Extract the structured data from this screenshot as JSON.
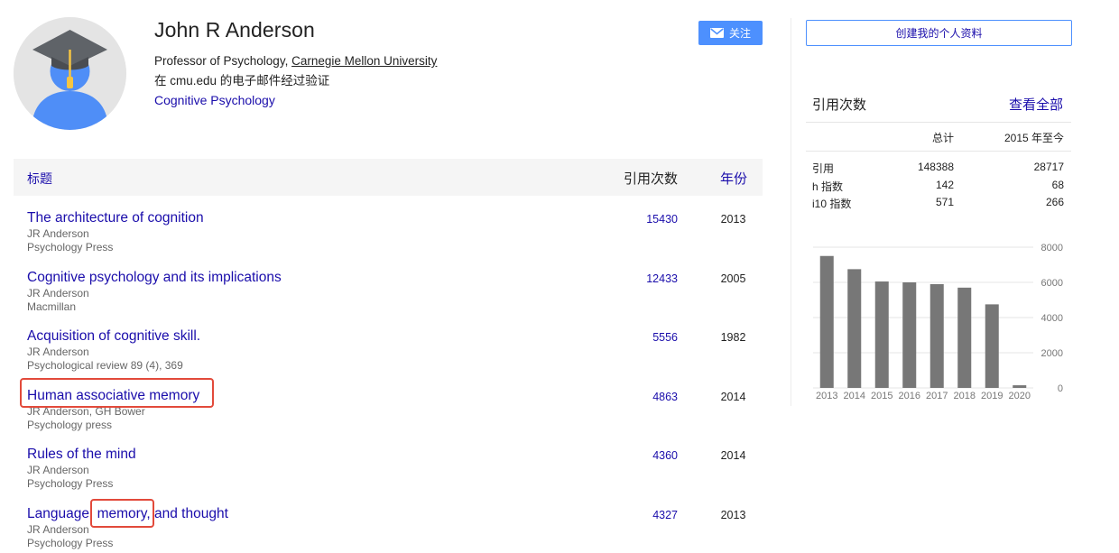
{
  "profile": {
    "name": "John R Anderson",
    "affiliation_prefix": "Professor of Psychology, ",
    "affiliation_org": "Carnegie Mellon University",
    "verified_email": "在 cmu.edu 的电子邮件经过验证",
    "interest": "Cognitive Psychology",
    "follow_label": "关注",
    "avatar_icon": "graduate-avatar-icon"
  },
  "table": {
    "header": {
      "title": "标题",
      "citations": "引用次数",
      "year": "年份"
    },
    "rows": [
      {
        "title": "The architecture of cognition",
        "authors": "JR Anderson",
        "venue": "Psychology Press",
        "citations": "15430",
        "year": "2013"
      },
      {
        "title": "Cognitive psychology and its implications",
        "authors": "JR Anderson",
        "venue": "Macmillan",
        "citations": "12433",
        "year": "2005"
      },
      {
        "title": "Acquisition of cognitive skill.",
        "authors": "JR Anderson",
        "venue": "Psychological review 89 (4), 369",
        "citations": "5556",
        "year": "1982"
      },
      {
        "title": "Human associative memory",
        "authors": "JR Anderson, GH Bower",
        "venue": "Psychology press",
        "citations": "4863",
        "year": "2014"
      },
      {
        "title": "Rules of the mind",
        "authors": "JR Anderson",
        "venue": "Psychology Press",
        "citations": "4360",
        "year": "2014"
      },
      {
        "title": "Language, memory, and thought",
        "authors": "JR Anderson",
        "venue": "Psychology Press",
        "citations": "4327",
        "year": "2013"
      }
    ]
  },
  "annotations": {
    "highlight_color": "#e24a3b"
  },
  "sidebar": {
    "create_profile_label": "创建我的个人资料",
    "cited_by_title": "引用次数",
    "view_all_label": "查看全部",
    "col_total": "总计",
    "col_since": "2015 年至今",
    "stats": [
      {
        "label": "引用",
        "total": "148388",
        "since": "28717"
      },
      {
        "label": "h 指数",
        "total": "142",
        "since": "68"
      },
      {
        "label": "i10 指数",
        "total": "571",
        "since": "266"
      }
    ]
  },
  "colors": {
    "link": "#1a0dab",
    "accent": "#4d90fe",
    "bar": "#777777"
  },
  "chart_data": {
    "type": "bar",
    "categories": [
      "2013",
      "2014",
      "2015",
      "2016",
      "2017",
      "2018",
      "2019",
      "2020"
    ],
    "values": [
      7500,
      6750,
      6050,
      6000,
      5900,
      5700,
      4750,
      150
    ],
    "y_ticks": [
      "8000",
      "6000",
      "4000",
      "2000",
      "0"
    ],
    "ylim": [
      0,
      8000
    ],
    "grid": true,
    "y_axis_side": "right"
  }
}
